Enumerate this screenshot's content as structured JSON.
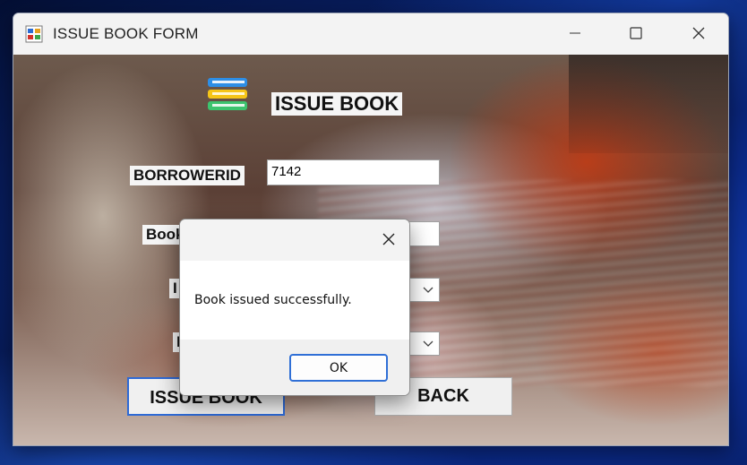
{
  "window": {
    "title": "ISSUE BOOK FORM",
    "icon": "winforms-app-icon"
  },
  "form": {
    "heading": "ISSUE BOOK",
    "heading_icon": "books-stack-icon",
    "borrower_label": "BORROWERID",
    "borrower_value": "7142",
    "book_label_visible": "Book",
    "issue_label_visible": "I",
    "due_label_visible": "I",
    "issue_button": "ISSUE BOOK",
    "back_button": "BACK"
  },
  "dialog": {
    "message": "Book issued successfully.",
    "ok_button": "OK"
  },
  "colors": {
    "focus_border": "#2e6ad6",
    "button_face": "#f0f0f0",
    "label_background": "#f5f5f5"
  }
}
